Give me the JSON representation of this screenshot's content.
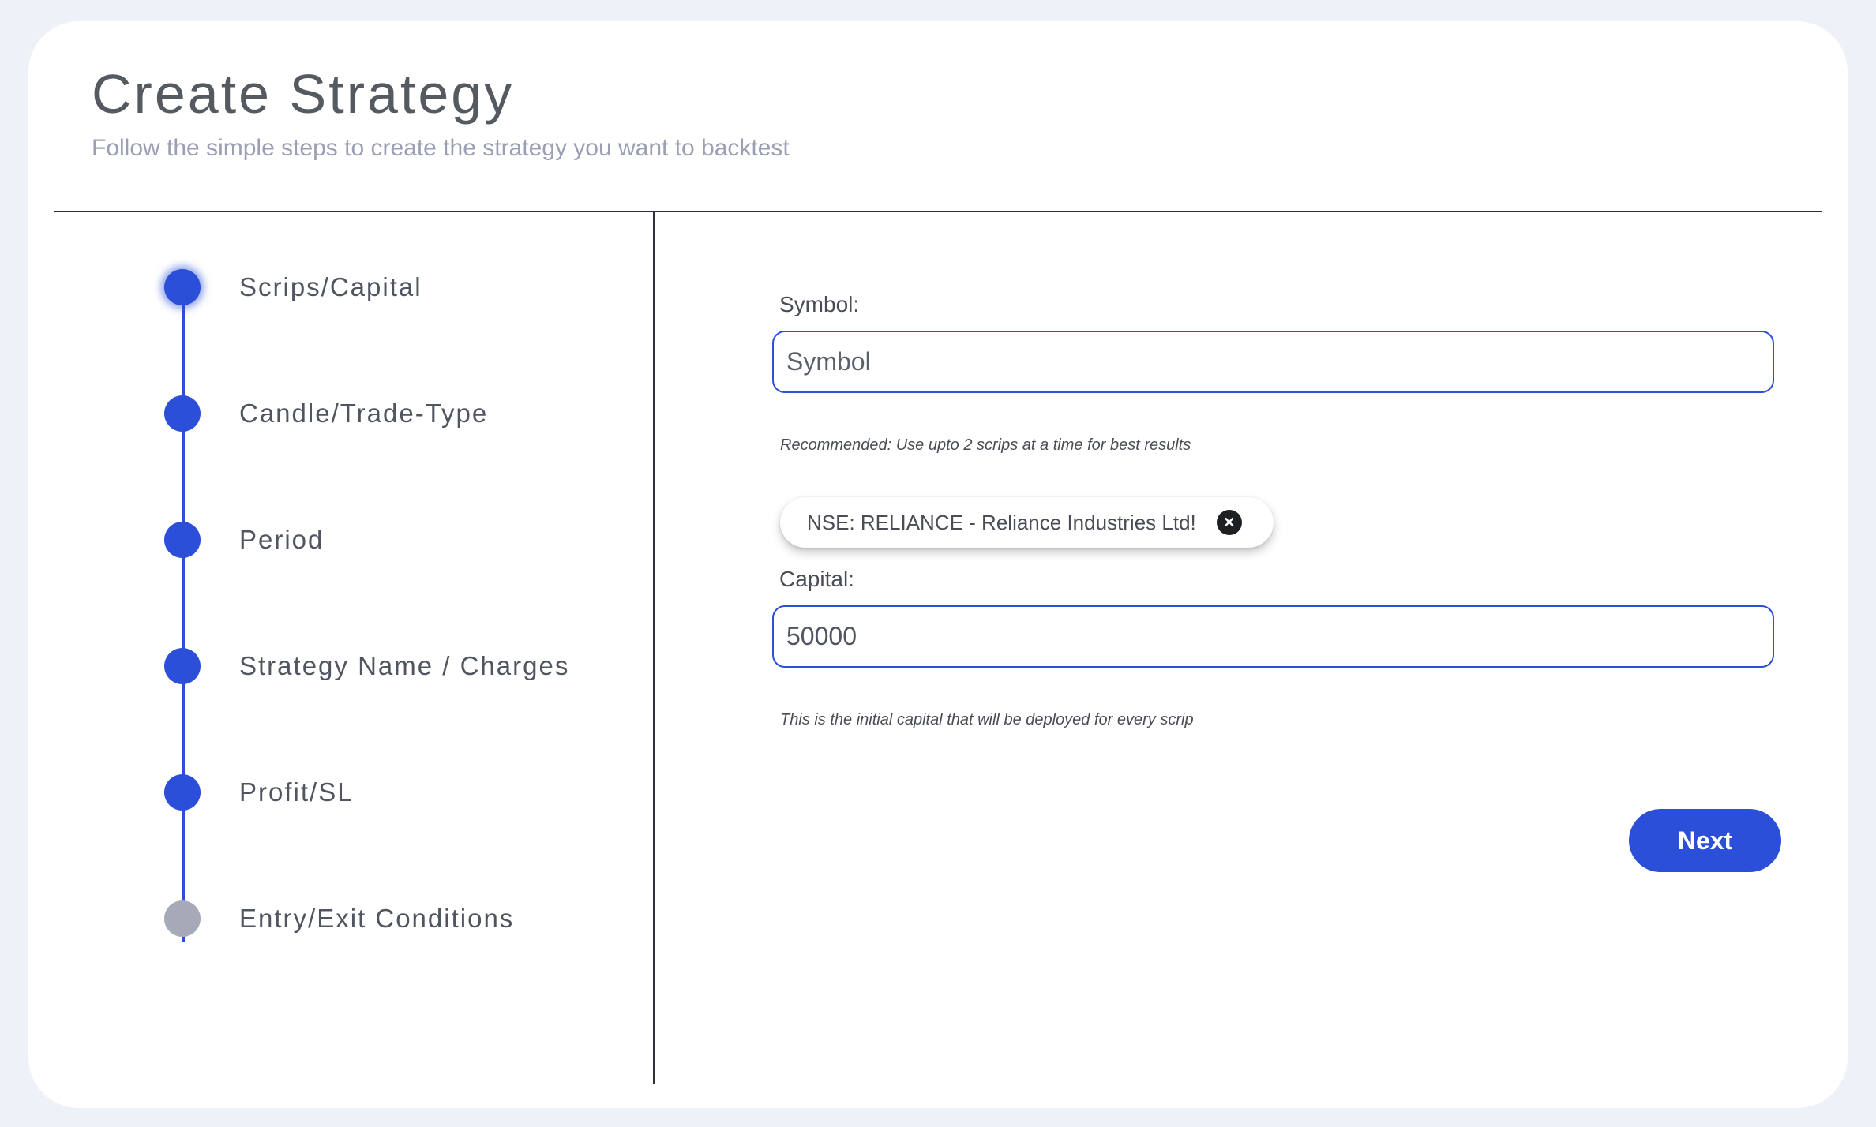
{
  "header": {
    "title": "Create Strategy",
    "subtitle": "Follow the simple steps to create the strategy you want to backtest"
  },
  "stepper": {
    "steps": [
      {
        "label": "Scrips/Capital",
        "state": "active"
      },
      {
        "label": "Candle/Trade-Type",
        "state": "complete"
      },
      {
        "label": "Period",
        "state": "complete"
      },
      {
        "label": "Strategy Name / Charges",
        "state": "complete"
      },
      {
        "label": "Profit/SL",
        "state": "complete"
      },
      {
        "label": "Entry/Exit Conditions",
        "state": "pending"
      }
    ]
  },
  "form": {
    "symbol": {
      "label": "Symbol:",
      "placeholder": "Symbol",
      "value": "",
      "hint": "Recommended: Use upto 2 scrips at a time for best results"
    },
    "selected_scrips": [
      {
        "label": "NSE: RELIANCE - Reliance Industries Ltd!",
        "remove_icon": "close-icon"
      }
    ],
    "capital": {
      "label": "Capital:",
      "value": "50000",
      "hint": "This is the initial capital that will be deployed for every scrip"
    },
    "next_label": "Next"
  },
  "colors": {
    "accent": "#2b4fd8",
    "pending": "#a6a9b8",
    "background": "#eef1f7"
  }
}
